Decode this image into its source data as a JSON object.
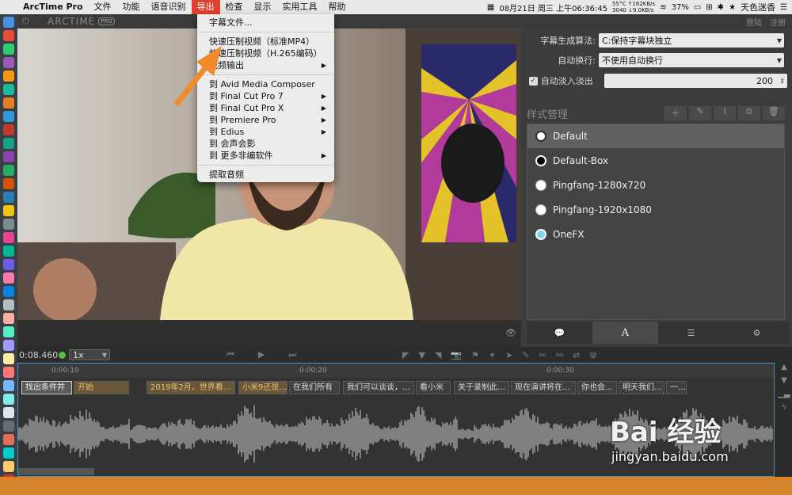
{
  "menubar": {
    "app_name": "ArcTime Pro",
    "items": [
      "文件",
      "功能",
      "语音识别",
      "导出",
      "检查",
      "显示",
      "实用工具",
      "帮助"
    ],
    "active_index": 3,
    "date_time": "08月21日 周三 上午06:36:45",
    "net_top": "55°C ↑162KB/s",
    "net_bottom": "3040 ↓9.0KB/s",
    "battery": "37%",
    "user": "天色迷香"
  },
  "titlebar": {
    "logo": "ARCTIME",
    "badge": "PRO",
    "login": "登陆",
    "register": "注册"
  },
  "export_menu": {
    "items": [
      {
        "label": "字幕文件...",
        "submenu": false
      },
      {
        "sep": true
      },
      {
        "label": "快速压制视频（标准MP4）",
        "submenu": false
      },
      {
        "label": "快速压制视频（H.265编码）",
        "submenu": false
      },
      {
        "label": "视频输出",
        "submenu": true
      },
      {
        "sep": true
      },
      {
        "label": "到 Avid Media Composer",
        "submenu": false
      },
      {
        "label": "到 Final Cut Pro 7",
        "submenu": true
      },
      {
        "label": "到 Final Cut Pro X",
        "submenu": true
      },
      {
        "label": "到 Premiere Pro",
        "submenu": true
      },
      {
        "label": "到 Edius",
        "submenu": true
      },
      {
        "label": "到 会声会影",
        "submenu": false
      },
      {
        "label": "到 更多非编软件",
        "submenu": true
      },
      {
        "sep": true
      },
      {
        "label": "提取音频",
        "submenu": false
      }
    ]
  },
  "settings": {
    "algo_label": "字幕生成算法:",
    "algo_value": "C:保持字幕块独立",
    "wrap_label": "自动换行:",
    "wrap_value": "不使用自动换行",
    "fade_label": "自动淡入淡出",
    "fade_value": "200",
    "style_mgmt_label": "样式管理"
  },
  "styles": [
    {
      "name": "Default",
      "color": "#ffffff",
      "selected": true
    },
    {
      "name": "Default-Box",
      "color": "#000000",
      "selected": false
    },
    {
      "name": "Pingfang-1280x720",
      "color": "#ffffff",
      "selected": false
    },
    {
      "name": "Pingfang-1920x1080",
      "color": "#ffffff",
      "selected": false
    },
    {
      "name": "OneFX",
      "color": "#7fd8f0",
      "selected": false
    }
  ],
  "player": {
    "time": "0:08.460",
    "speed": "1x"
  },
  "timeline": {
    "ticks": [
      "0:00:10",
      "0:00:20",
      "0:00:30"
    ],
    "subtitles": [
      {
        "text": "找出条件并",
        "kind": "hl"
      },
      {
        "text": "开始",
        "kind": "hl"
      },
      {
        "text": "2019年2月，世界看…",
        "kind": "hl"
      },
      {
        "text": "小米9还是…",
        "kind": "hl"
      },
      {
        "text": "在我们所有",
        "kind": "normal"
      },
      {
        "text": "我们可以谈谈，…",
        "kind": "normal"
      },
      {
        "text": "看小米",
        "kind": "normal"
      },
      {
        "text": "关于录制此…",
        "kind": "normal"
      },
      {
        "text": "现在演讲将在…",
        "kind": "normal"
      },
      {
        "text": "你也会…",
        "kind": "normal"
      },
      {
        "text": "明天我们…",
        "kind": "normal"
      },
      {
        "text": "一…",
        "kind": "normal"
      }
    ]
  },
  "watermark": {
    "brand": "Bai 经验",
    "url": "jingyan.baidu.com"
  }
}
